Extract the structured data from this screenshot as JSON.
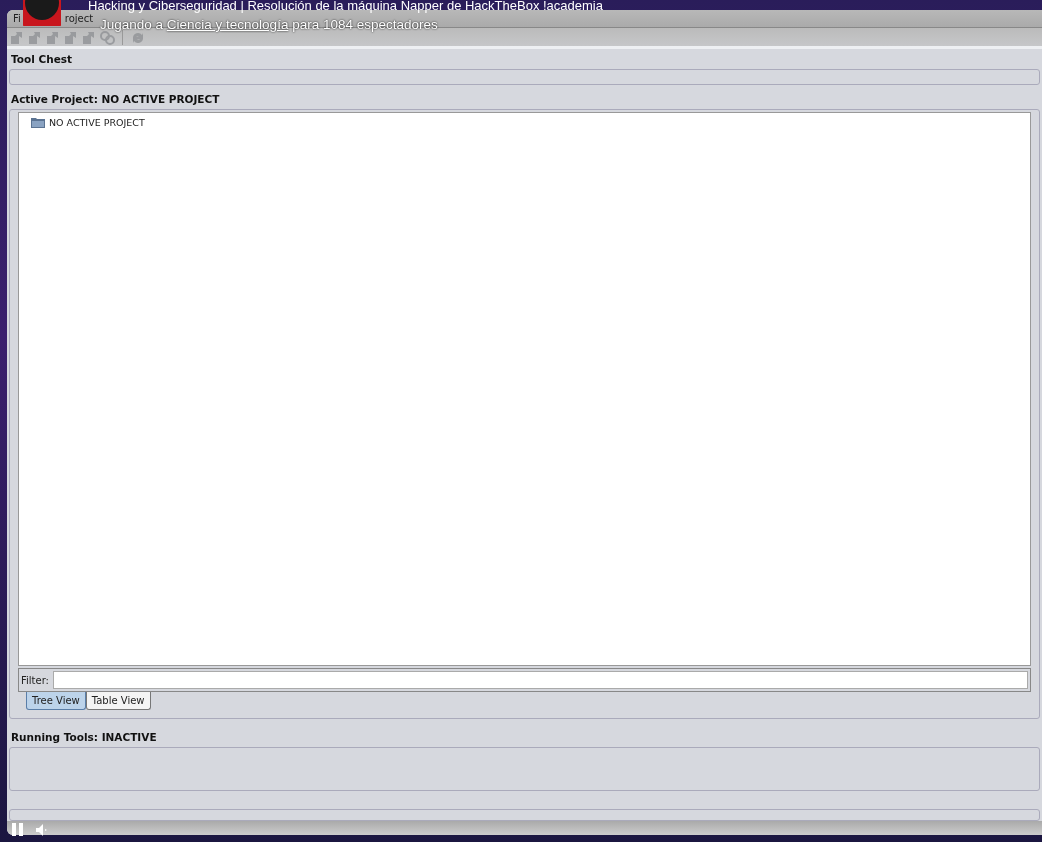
{
  "stream": {
    "title": "Hacking y Ciberseguridad | Resolución de la máquina Napper de HackTheBox !academia",
    "subtitle_before": "Jugando a",
    "subtitle_link": "Ciencia y tecnología",
    "subtitle_after": "para 1084 espectadores"
  },
  "menu": [
    "Fi",
    "roject"
  ],
  "toolbar": [
    {
      "kind": "tool",
      "disabled": true
    },
    {
      "kind": "tool",
      "disabled": true
    },
    {
      "kind": "tool",
      "disabled": true
    },
    {
      "kind": "tool",
      "disabled": true
    },
    {
      "kind": "tool",
      "disabled": true
    },
    {
      "kind": "link",
      "disabled": true
    },
    {
      "kind": "separator"
    },
    {
      "kind": "refresh",
      "disabled": true
    }
  ],
  "tool_chest": {
    "label": "Tool Chest"
  },
  "active_project": {
    "label": "Active Project: NO ACTIVE PROJECT",
    "tree": [
      {
        "label": "NO ACTIVE PROJECT"
      }
    ],
    "filter": {
      "label": "Filter:"
    },
    "tabs": [
      {
        "label": "Tree View",
        "selected": true
      },
      {
        "label": "Table View",
        "selected": false
      }
    ]
  },
  "running_tools": {
    "label": "Running Tools: INACTIVE"
  }
}
